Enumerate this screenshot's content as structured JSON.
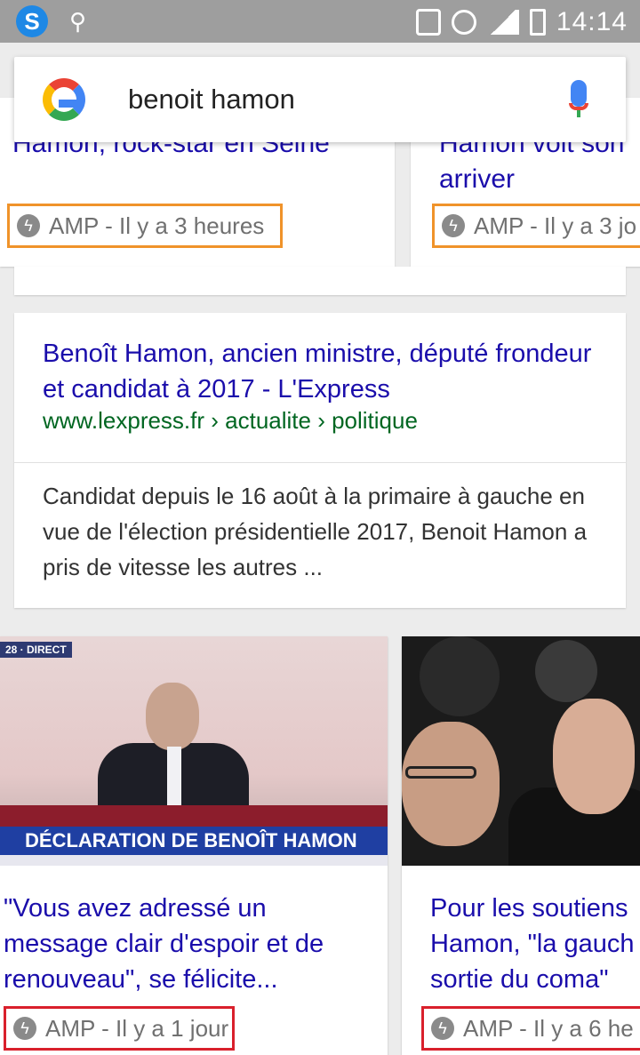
{
  "status_bar": {
    "time": "14:14",
    "icons": [
      "swiftkey-icon",
      "usb-icon",
      "vibrate-icon",
      "alarm-icon",
      "signal-icon",
      "battery-icon"
    ]
  },
  "search": {
    "query": "benoit hamon",
    "logo": "google-logo",
    "mic_icon": "mic-icon"
  },
  "top_carousel": [
    {
      "title": "Hamon, rock-star en Seine",
      "meta": "AMP - Il y a 3 heures"
    },
    {
      "title": "Hamon voit son\narriver",
      "title_line1": "Hamon voit son",
      "title_line2": "arriver",
      "meta": "AMP - Il y a 3 jo"
    }
  ],
  "result": {
    "title": "Benoît Hamon, ancien ministre, député frondeur et candidat à 2017 - L'Express",
    "url": "www.lexpress.fr › actualite › politique",
    "snippet": "Candidat depuis le 16 août à la primaire à gauche en vue de l'élection présidentielle 2017, Benoit Hamon a pris de vitesse les autres ..."
  },
  "news_carousel": [
    {
      "title": "\"Vous avez adressé un message clair d'espoir et de renouveau\", se félicite...",
      "meta": "AMP - Il y a 1 jour",
      "image": {
        "direct_label": "28 · DIRECT",
        "banner": "DÉCLARATION DE BENOÎT HAMON"
      }
    },
    {
      "title": "Pour les soutiens\nHamon, \"la gauch\nsortie du coma\"",
      "title_line1": "Pour les soutiens",
      "title_line2": "Hamon, \"la gauch",
      "title_line3": "sortie du coma\"",
      "meta": "AMP - Il y a 6 he"
    }
  ],
  "colors": {
    "link": "#1a0dab",
    "url": "#006621",
    "highlight_orange": "#f0932a",
    "highlight_red": "#d9202c"
  }
}
